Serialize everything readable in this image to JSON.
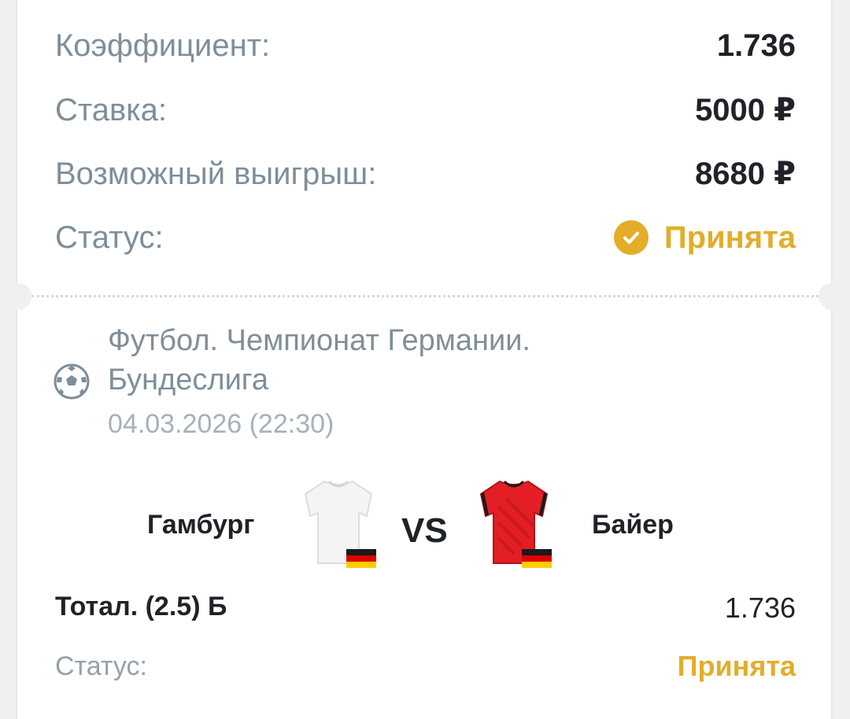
{
  "summary": {
    "coefficient_label": "Коэффициент:",
    "coefficient_value": "1.736",
    "stake_label": "Ставка:",
    "stake_value": "5000 ₽",
    "payout_label": "Возможный выигрыш:",
    "payout_value": "8680 ₽",
    "status_label": "Статус:",
    "status_value": "Принята"
  },
  "event": {
    "sport_icon": "football-icon",
    "league": "Футбол. Чемпионат Германии. Бундеслига",
    "datetime": "04.03.2026 (22:30)",
    "home_team": "Гамбург",
    "away_team": "Байер",
    "vs_label": "VS",
    "home_jersey_color": "#f4f4f4",
    "away_jersey_color": "#e31e24"
  },
  "selection": {
    "market": "Тотал. (2.5) Б",
    "odd": "1.736",
    "status_label": "Статус:",
    "status_value": "Принята"
  },
  "colors": {
    "accent": "#e3ad2a",
    "muted": "#7f8e99",
    "text": "#1f2328"
  }
}
